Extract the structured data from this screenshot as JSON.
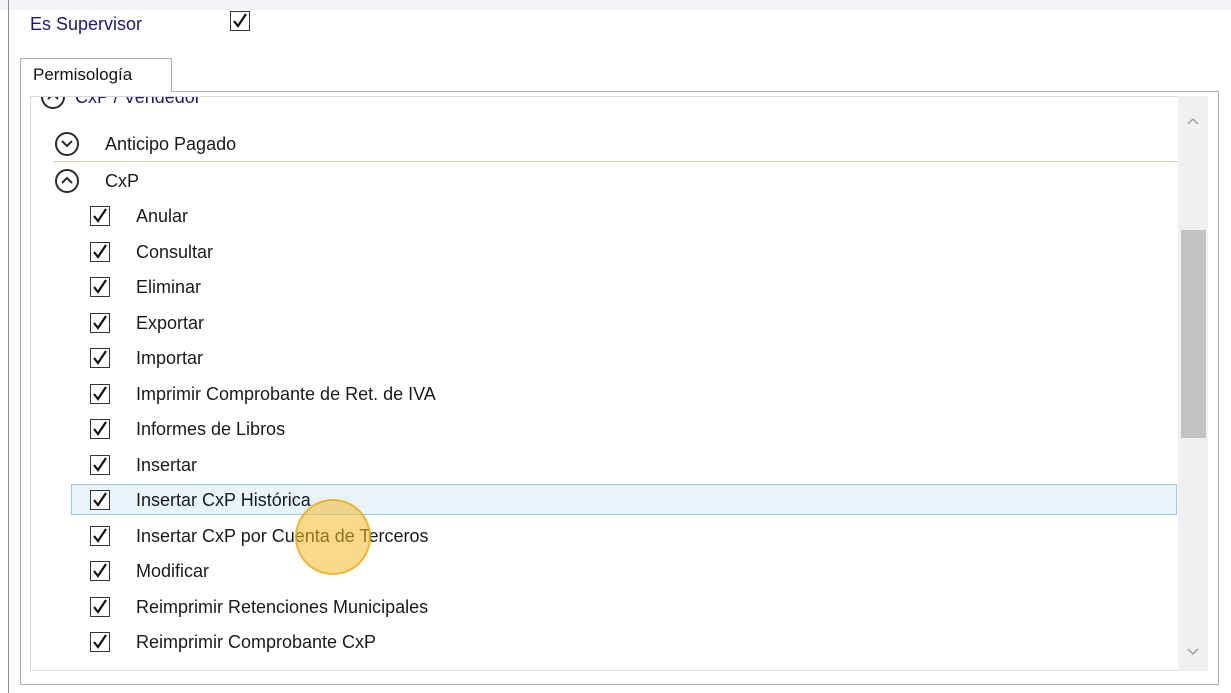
{
  "supervisor": {
    "label": "Es Supervisor",
    "checked": true
  },
  "tab": {
    "label": "Permisología"
  },
  "tree": {
    "partial_group": "CxP / Vendedor",
    "groups": [
      {
        "label": "Anticipo Pagado",
        "state": "collapsed"
      },
      {
        "label": "CxP",
        "state": "expanded"
      }
    ],
    "items": [
      {
        "label": "Anular",
        "checked": true
      },
      {
        "label": "Consultar",
        "checked": true
      },
      {
        "label": "Eliminar",
        "checked": true
      },
      {
        "label": "Exportar",
        "checked": true
      },
      {
        "label": "Importar",
        "checked": true
      },
      {
        "label": "Imprimir Comprobante de Ret. de IVA",
        "checked": true
      },
      {
        "label": "Informes de Libros",
        "checked": true
      },
      {
        "label": "Insertar",
        "checked": true
      },
      {
        "label": "Insertar CxP Histórica",
        "checked": true,
        "selected": true
      },
      {
        "label": "Insertar CxP por Cuenta de Terceros",
        "checked": true
      },
      {
        "label": "Modificar",
        "checked": true
      },
      {
        "label": "Reimprimir  Retenciones Municipales",
        "checked": true
      },
      {
        "label": "Reimprimir Comprobante CxP",
        "checked": true
      }
    ]
  },
  "icons": {
    "scroll_up": "chevron-up-icon",
    "scroll_down": "chevron-down-icon",
    "expand": "chevron-down-circle-icon",
    "collapse": "chevron-up-circle-icon",
    "check": "checkmark-icon"
  },
  "colors": {
    "label_blue": "#1a1a6e",
    "selection_fill": "#e8f3fc",
    "selection_border": "#99c9ef",
    "cursor_highlight": "#f4bc2a"
  }
}
